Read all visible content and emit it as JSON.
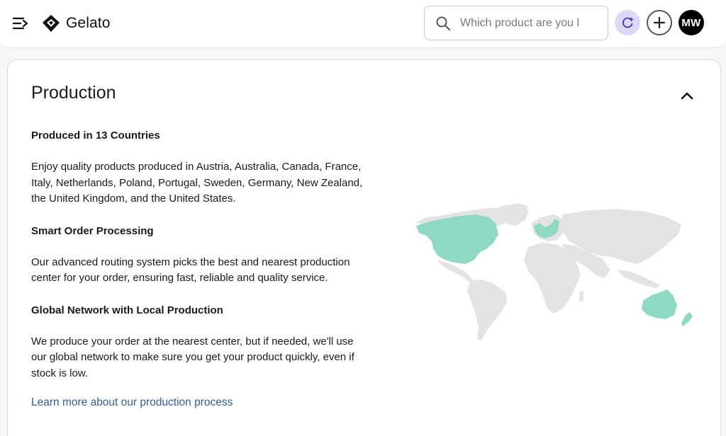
{
  "header": {
    "brand": "Gelato",
    "search": {
      "placeholder": "Which product are you l",
      "value": ""
    },
    "avatar_initials": "MW"
  },
  "production": {
    "title": "Production",
    "sections": [
      {
        "heading": "Produced in 13 Countries",
        "body": "Enjoy quality products produced in Austria, Australia, Canada, France, Italy, Netherlands, Poland, Portugal, Sweden, Germany, New Zealand, the United Kingdom, and the United States."
      },
      {
        "heading": "Smart Order Processing",
        "body": "Our advanced routing system picks the best and nearest production center for your order, ensuring fast, reliable and quality service."
      },
      {
        "heading": "Global Network with Local Production",
        "body": "We produce your order at the nearest center, but if needed, we'll use our global network to make sure you get your product quickly, even if stock is low."
      }
    ],
    "link": "Learn more about our production process"
  },
  "colors": {
    "accent_map": "#8fd9c2",
    "map_gray": "#e3e3e3",
    "link": "#2f5aa8",
    "ai_button_bg": "#ddd8f5"
  },
  "icons": [
    "menu-icon",
    "gelato-logo-icon",
    "search-icon",
    "ai-sparkle-icon",
    "plus-icon",
    "chevron-up-icon"
  ]
}
